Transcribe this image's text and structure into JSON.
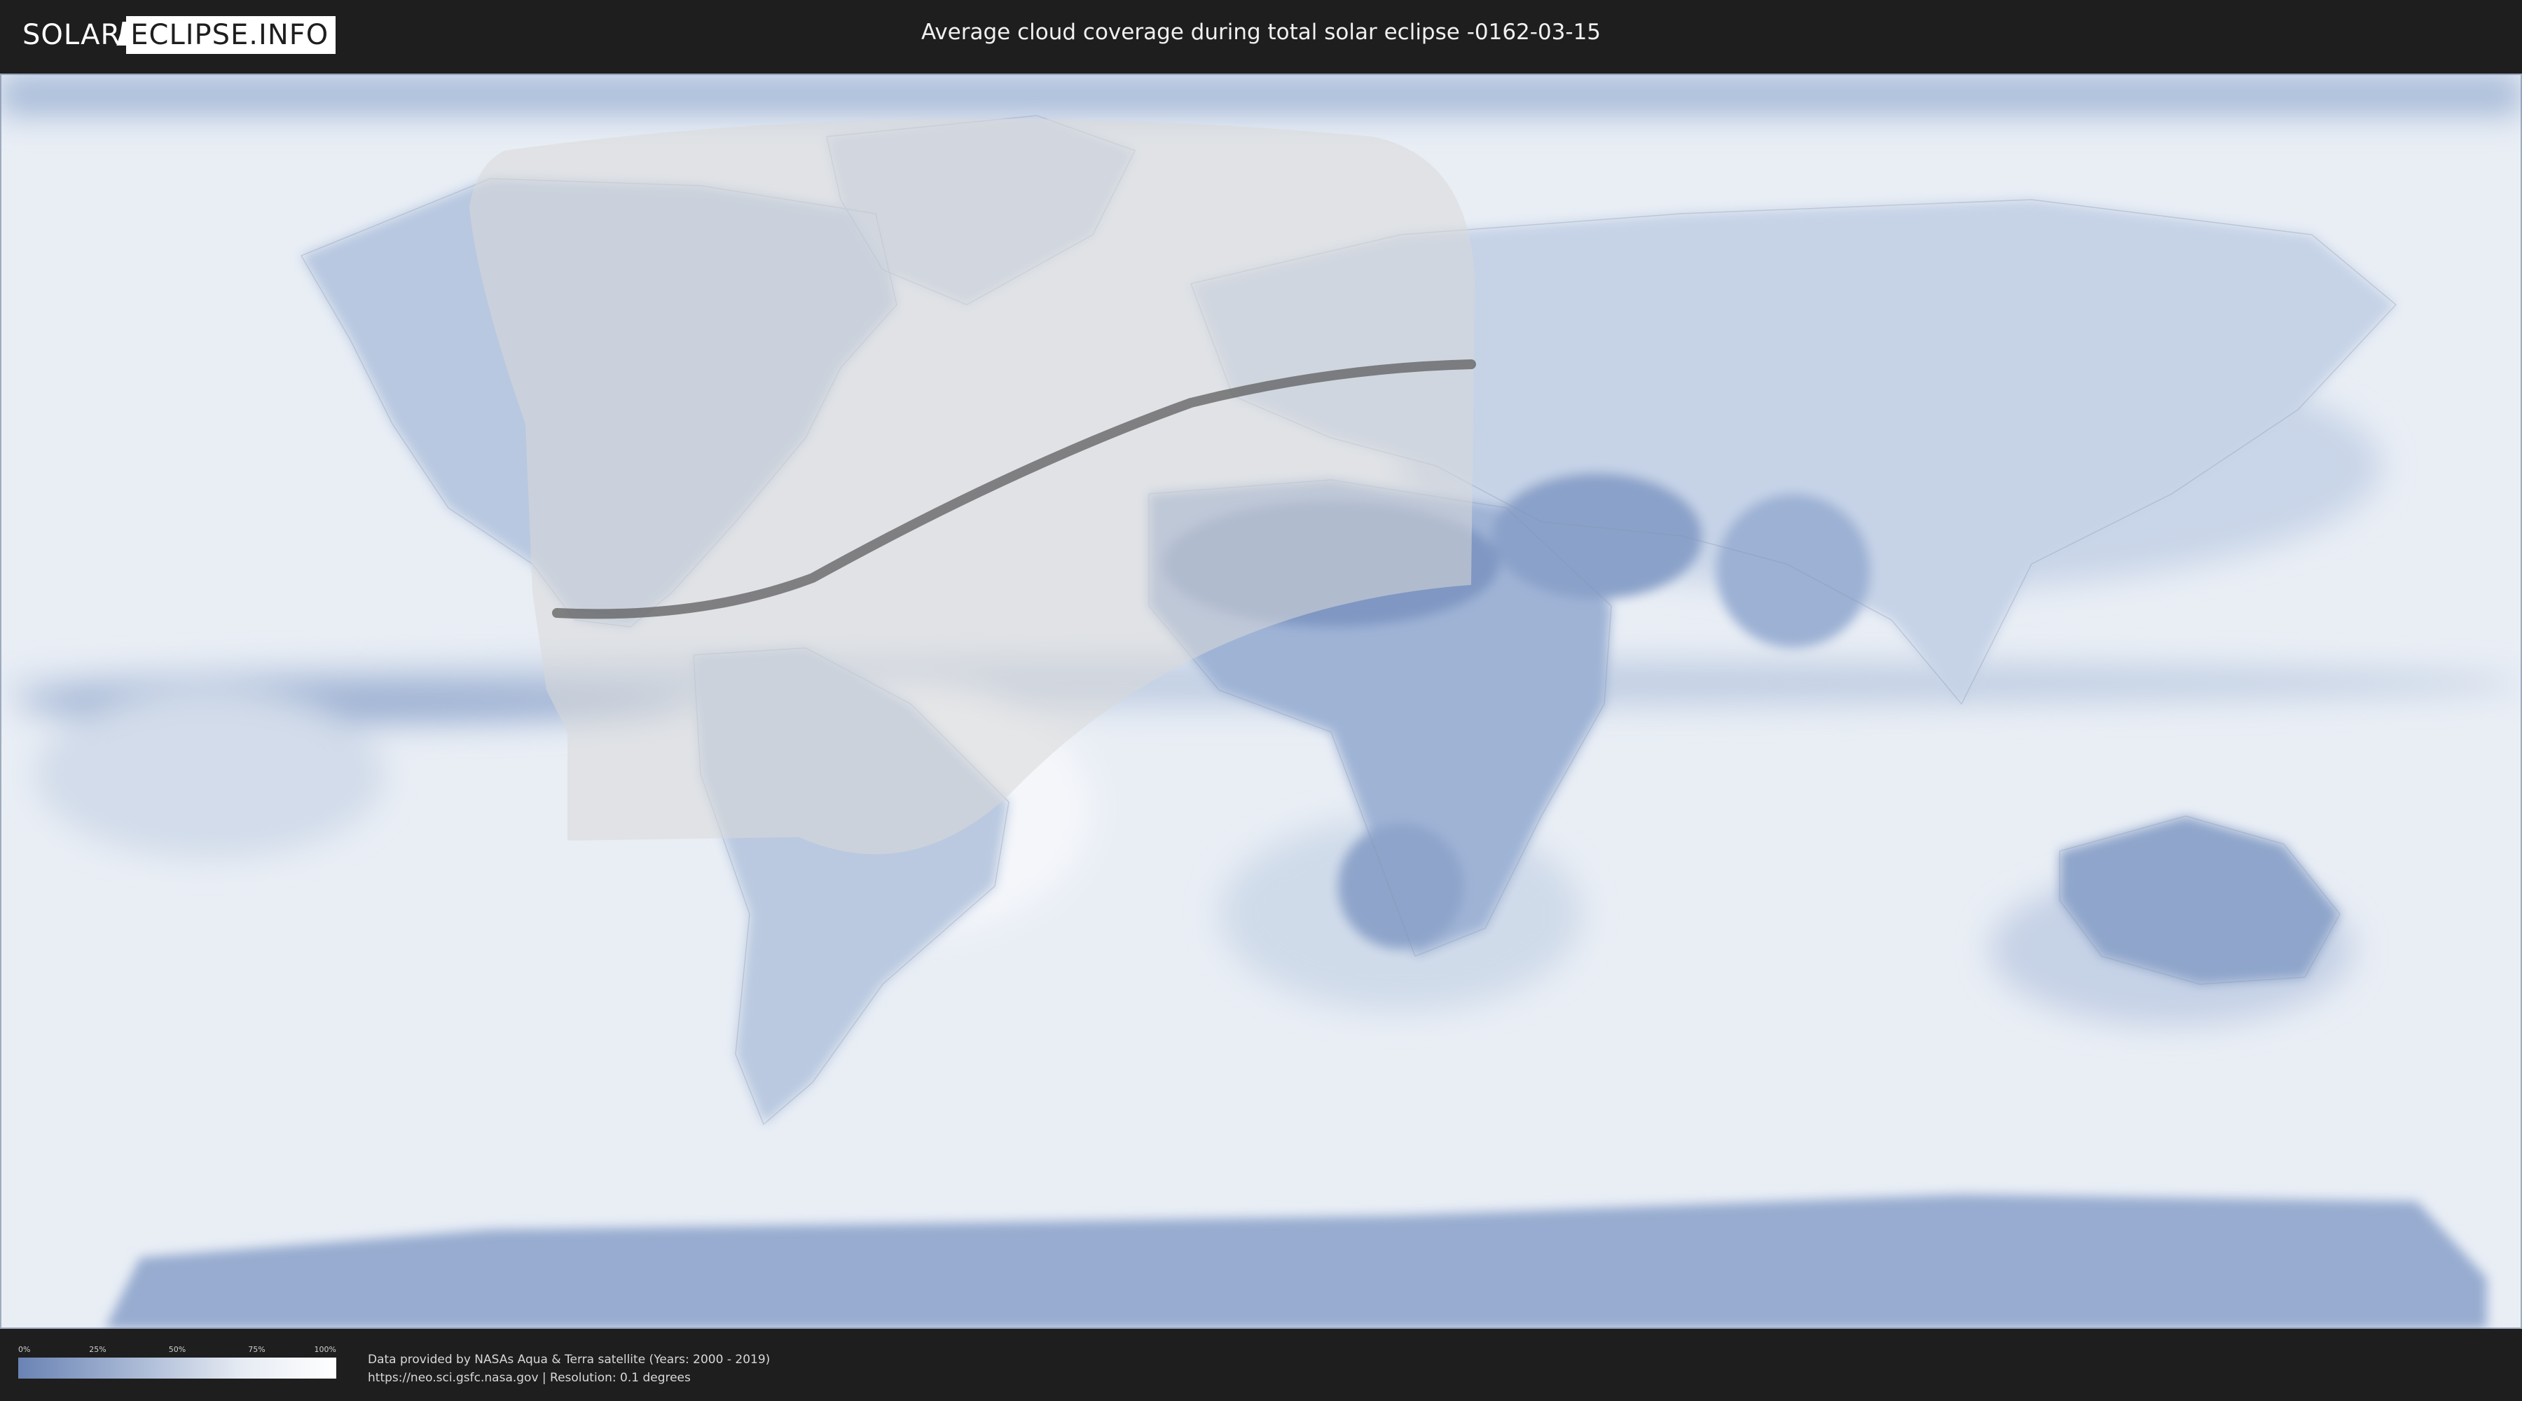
{
  "header": {
    "logo_left": "SOLAR",
    "logo_right": "ECLIPSE.INFO",
    "title": "Average cloud coverage during total solar eclipse -0162-03-15"
  },
  "legend": {
    "ticks": [
      "0%",
      "25%",
      "50%",
      "75%",
      "100%"
    ],
    "colors": {
      "low": "#6a83b4",
      "high": "#ffffff"
    }
  },
  "credits": {
    "line1": "Data provided by NASAs Aqua & Terra satellite (Years: 2000 - 2019)",
    "line2": "https://neo.sci.gsfc.nasa.gov | Resolution: 0.1 degrees"
  },
  "colors": {
    "background": "#1e1e1e",
    "ocean_cloud": "#e9eef5",
    "clear_land": "#7f97c2",
    "eclipse_zone": "#d8d8d8",
    "totality_path": "#555555"
  }
}
